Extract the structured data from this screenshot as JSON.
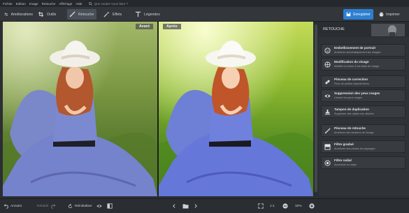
{
  "menu": {
    "items": [
      "Fichier",
      "Edition",
      "Image",
      "Retouche",
      "Affichage",
      "Aide"
    ],
    "search_placeholder": "Que voulez-vous faire ?"
  },
  "toolbar": {
    "tabs": [
      {
        "label": "Améliorations",
        "icon": "sliders-icon"
      },
      {
        "label": "Outils",
        "icon": "crop-icon"
      },
      {
        "label": "Retouche",
        "icon": "brush-icon",
        "active": true
      },
      {
        "label": "Effets",
        "icon": "magic-wand-icon"
      },
      {
        "label": "Légendes",
        "icon": "text-icon"
      }
    ],
    "save_label": "Enregistrer",
    "print_label": "Imprimer",
    "accent": "#2d7fd2"
  },
  "canvas": {
    "before_label": "Avant",
    "after_label": "Après"
  },
  "panel": {
    "title": "RETOUCHE",
    "items": [
      {
        "title": "Embellissement de portrait",
        "subtitle": "Améliorer automatiquement les visages",
        "icon": "face-icon"
      },
      {
        "title": "Modification du visage",
        "subtitle": "Modifier la forme & les traits du visage",
        "icon": "globe-face-icon"
      },
      {
        "title": "Pinceau de correction",
        "subtitle": "Fixer de petites imperfections",
        "icon": "bandage-icon"
      },
      {
        "title": "Suppression des yeux rouges",
        "subtitle": "Liminer les yeux rouges",
        "icon": "eye-icon"
      },
      {
        "title": "Tampon de duplication",
        "subtitle": "Supprimer des objets non désirés",
        "icon": "stamp-icon"
      },
      {
        "title": "Pinceau de retouche",
        "subtitle": "Améliorer des sections de l'image",
        "icon": "brush-icon"
      },
      {
        "title": "Filtre gradué",
        "subtitle": "Améliorer des photos de paysages",
        "icon": "gradient-filter-icon"
      },
      {
        "title": "Filtre radial",
        "subtitle": "Accentuer un objet",
        "icon": "radial-filter-icon"
      }
    ]
  },
  "bottombar": {
    "undo_label": "Annuler",
    "redo_label": "Rétablir",
    "reset_label": "Réinitialiser",
    "ratio_label": "1:1",
    "zoom_label": "32%",
    "zoom_value": 0.32
  }
}
